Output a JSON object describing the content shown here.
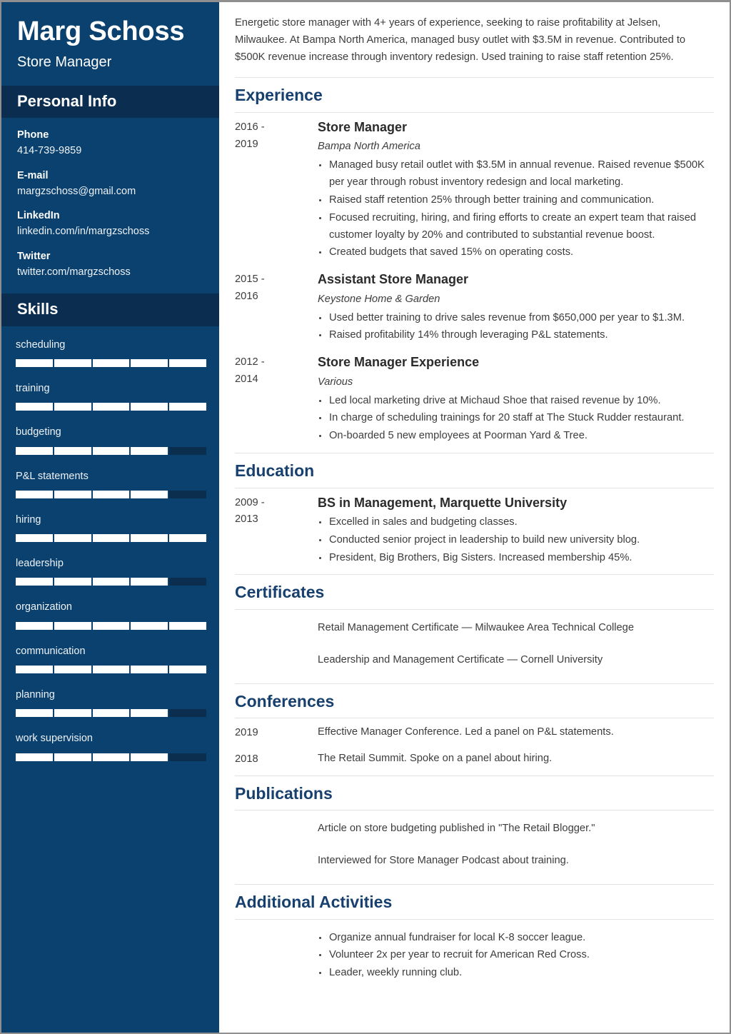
{
  "sidebar": {
    "name": "Marg Schoss",
    "title": "Store Manager",
    "personal_info_heading": "Personal Info",
    "contacts": [
      {
        "label": "Phone",
        "value": "414-739-9859"
      },
      {
        "label": "E-mail",
        "value": "margzschoss@gmail.com"
      },
      {
        "label": "LinkedIn",
        "value": "linkedin.com/in/margzschoss"
      },
      {
        "label": "Twitter",
        "value": "twitter.com/margzschoss"
      }
    ],
    "skills_heading": "Skills",
    "skills": [
      {
        "name": "scheduling",
        "level": 100
      },
      {
        "name": "training",
        "level": 100
      },
      {
        "name": "budgeting",
        "level": 80
      },
      {
        "name": "P&L statements",
        "level": 80
      },
      {
        "name": "hiring",
        "level": 100
      },
      {
        "name": "leadership",
        "level": 80
      },
      {
        "name": "organization",
        "level": 100
      },
      {
        "name": "communication",
        "level": 100
      },
      {
        "name": "planning",
        "level": 80
      },
      {
        "name": "work supervision",
        "level": 80
      }
    ],
    "colors": {
      "sidebar_bg": "#0a416f",
      "section_head_bg": "#0a2d50",
      "skill_track": "#0b2e4f",
      "skill_fill": "#ffffff"
    }
  },
  "main": {
    "summary": "Energetic store manager with 4+ years of experience, seeking to raise profitability at Jelsen, Milwaukee. At Bampa North America, managed busy outlet with $3.5M in revenue. Contributed to $500K revenue increase through inventory redesign. Used training to raise staff retention 25%.",
    "heading_color": "#17406e",
    "experience": {
      "heading": "Experience",
      "entries": [
        {
          "date": "2016 -\n2019",
          "date_line1": "2016 -",
          "date_line2": "2019",
          "title": "Store Manager",
          "subtitle": "Bampa North America",
          "bullets": [
            "Managed busy retail outlet with $3.5M in annual revenue. Raised revenue $500K per year through robust inventory redesign and local marketing.",
            "Raised staff retention 25% through better training and communication.",
            "Focused recruiting, hiring, and firing efforts to create an expert team that raised customer loyalty by 20% and contributed to substantial revenue boost.",
            "Created budgets that saved 15% on operating costs."
          ]
        },
        {
          "date_line1": "2015 -",
          "date_line2": "2016",
          "title": "Assistant Store Manager",
          "subtitle": "Keystone Home & Garden",
          "bullets": [
            "Used better training to drive sales revenue from $650,000 per year to $1.3M.",
            "Raised profitability 14% through leveraging P&L statements."
          ]
        },
        {
          "date_line1": "2012 -",
          "date_line2": "2014",
          "title": "Store Manager Experience",
          "subtitle": "Various",
          "bullets": [
            "Led local marketing drive at Michaud Shoe that raised revenue by 10%.",
            "In charge of scheduling trainings for 20 staff at The Stuck Rudder restaurant.",
            "On-boarded 5 new employees at Poorman Yard & Tree."
          ]
        }
      ]
    },
    "education": {
      "heading": "Education",
      "entries": [
        {
          "date_line1": "2009 -",
          "date_line2": "2013",
          "title": "BS in Management, Marquette University",
          "bullets": [
            "Excelled in sales and budgeting classes.",
            "Conducted senior project in leadership to build new university blog.",
            "President, Big Brothers, Big Sisters. Increased membership 45%."
          ]
        }
      ]
    },
    "certificates": {
      "heading": "Certificates",
      "items": [
        "Retail Management Certificate — Milwaukee Area Technical College",
        "Leadership and Management Certificate — Cornell University"
      ]
    },
    "conferences": {
      "heading": "Conferences",
      "entries": [
        {
          "date": "2019",
          "text": "Effective Manager Conference. Led a panel on P&L statements."
        },
        {
          "date": "2018",
          "text": "The Retail Summit. Spoke on a panel about hiring."
        }
      ]
    },
    "publications": {
      "heading": "Publications",
      "items": [
        "Article on store budgeting published in \"The Retail Blogger.\"",
        "Interviewed for Store Manager Podcast about training."
      ]
    },
    "additional_activities": {
      "heading": "Additional Activities",
      "bullets": [
        "Organize annual fundraiser for local K-8 soccer league.",
        "Volunteer 2x per year to recruit for American Red Cross.",
        "Leader, weekly running club."
      ]
    }
  }
}
